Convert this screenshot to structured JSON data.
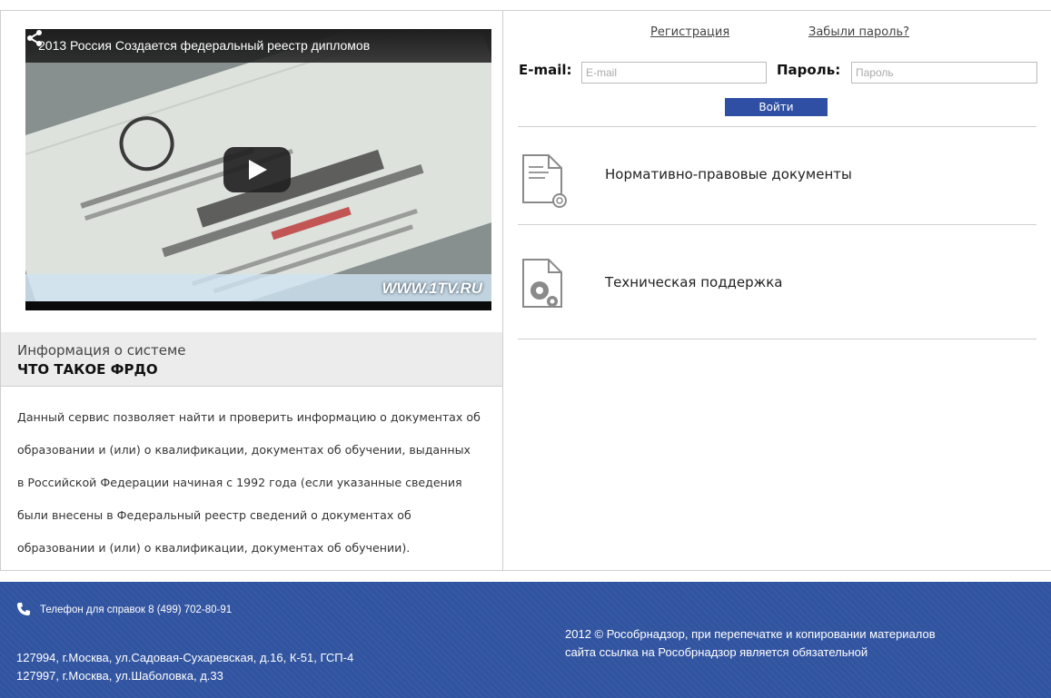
{
  "video": {
    "title": "2013 Россия Создается федеральный реестр дипломов",
    "watermark": "WWW.1TV.RU"
  },
  "info": {
    "subtitle": "Информация о системе",
    "title": "ЧТО ТАКОЕ ФРДО",
    "lines": [
      "Данный сервис позволяет найти и проверить информацию о документах об",
      "образовании и (или) о квалификации, документах об обучении, выданных",
      "в Российской Федерации начиная с 1992 года (если указанные сведения",
      "были внесены в Федеральный реестр сведений о документах об",
      "образовании и (или) о квалификации, документах об обучении)."
    ]
  },
  "auth": {
    "register_label": "Регистрация",
    "forgot_label": "Забыли пароль?",
    "email_label": "E-mail:",
    "email_placeholder": "E-mail",
    "password_label": "Пароль:",
    "password_placeholder": "Пароль",
    "login_label": "Войти"
  },
  "menu": {
    "items": [
      {
        "label": "Нормативно-правовые документы",
        "icon": "document-icon"
      },
      {
        "label": "Техническая поддержка",
        "icon": "support-gear-icon"
      }
    ]
  },
  "footer": {
    "phone": "Телефон для справок 8 (499) 702-80-91",
    "address_lines": [
      "127994, г.Москва, ул.Садовая-Сухаревская, д.16, К-51, ГСП-4",
      "127997, г.Москва, ул.Шаболовка, д.33"
    ],
    "copyright_lines": [
      "2012 © Рособрнадзор, при перепечатке и копировании материалов",
      "сайта ссылка на Рособрнадзор является обязательной"
    ]
  },
  "colors": {
    "accent": "#2e4fa3",
    "footer_bg": "#3154a0"
  }
}
